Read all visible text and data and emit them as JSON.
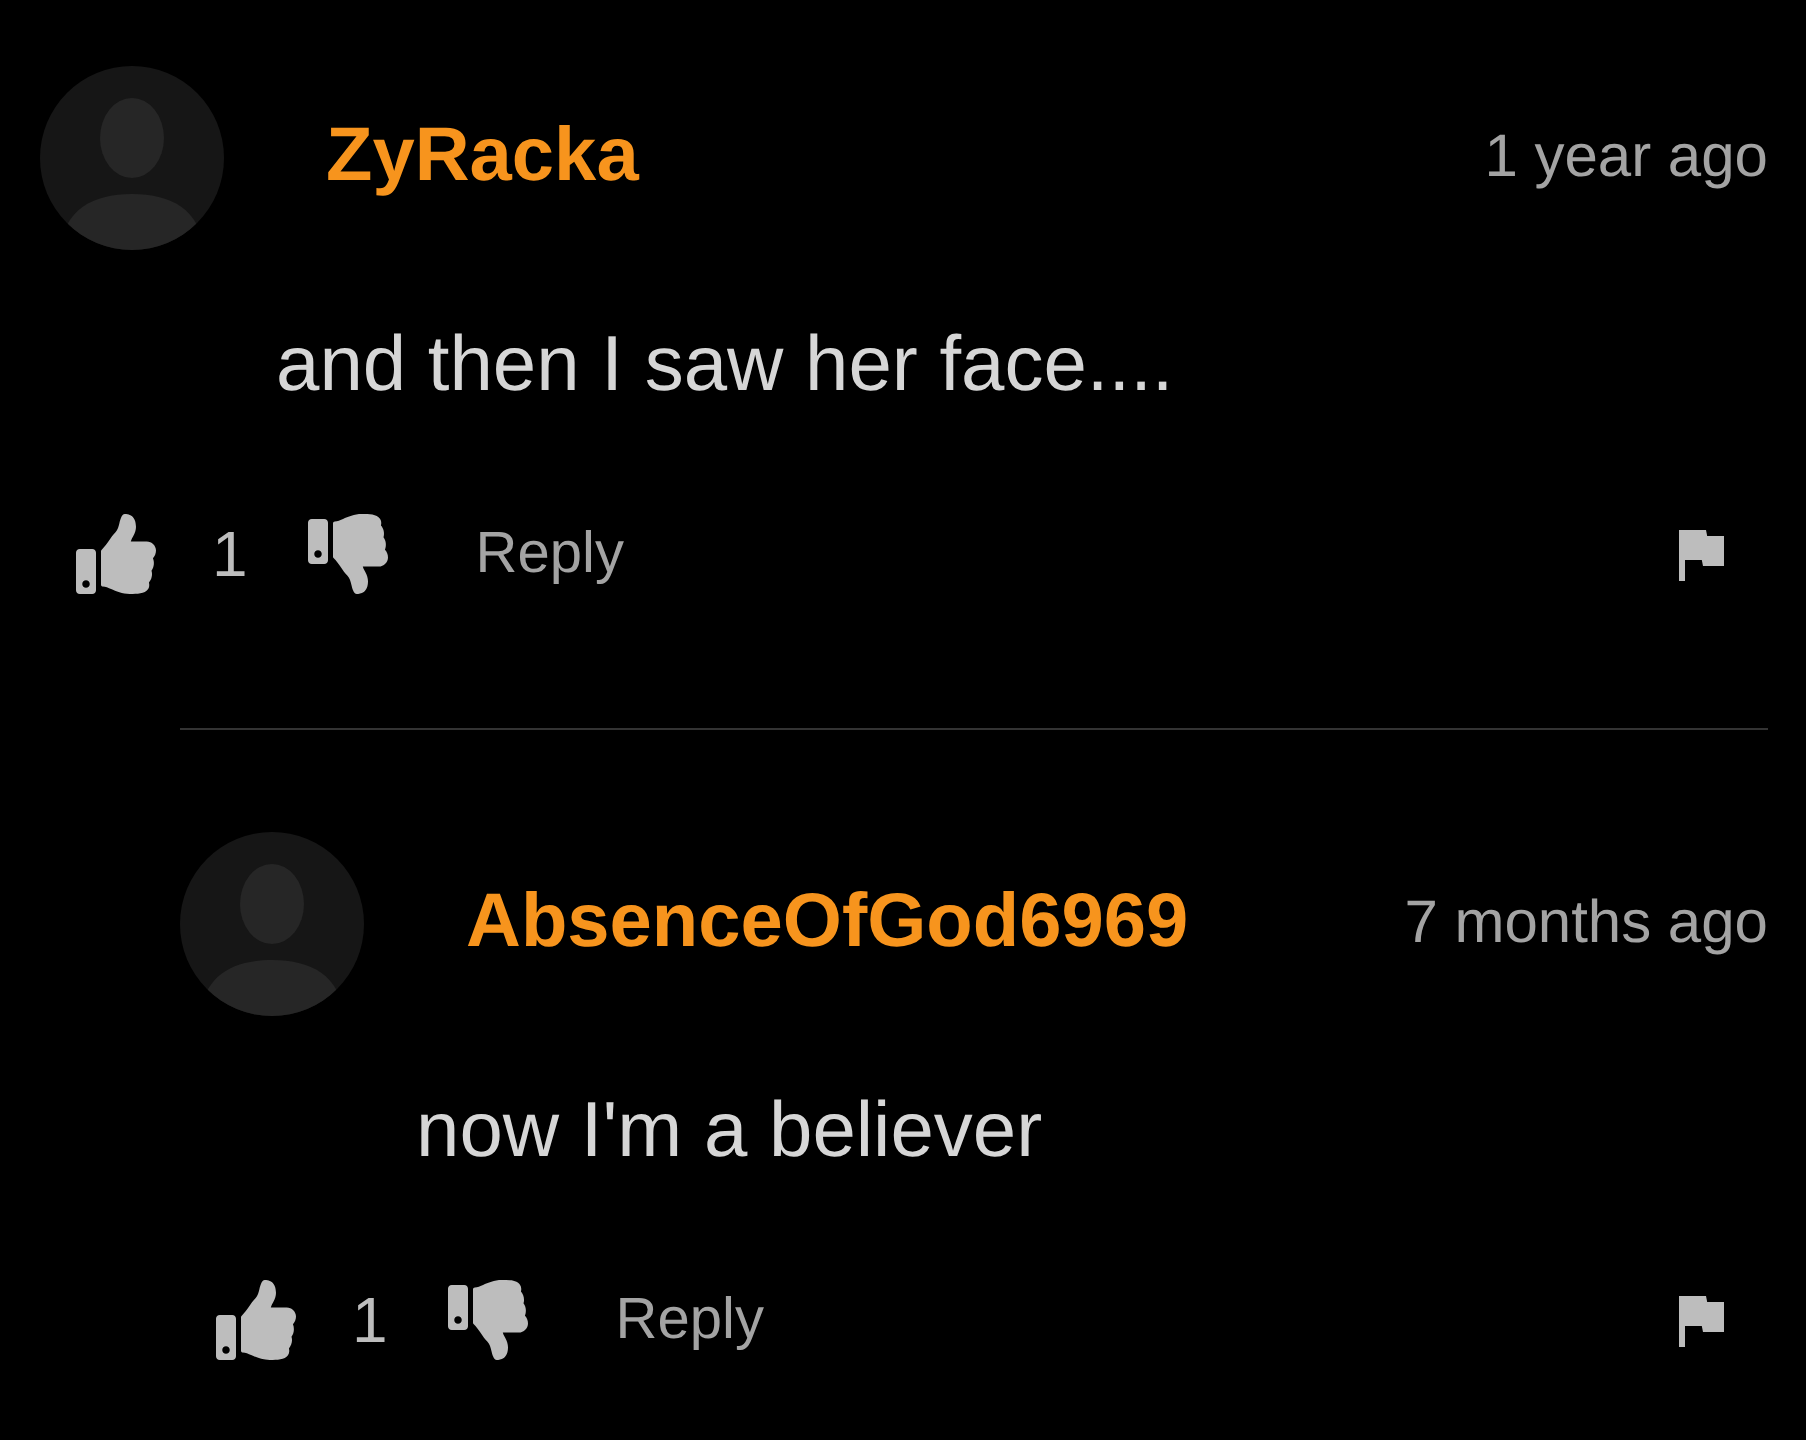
{
  "comments": [
    {
      "author": "ZyRacka",
      "time": "1 year ago",
      "text": "and then I saw her face....",
      "likes": "1",
      "reply_label": "Reply",
      "replies": [
        {
          "author": "AbsenceOfGod6969",
          "time": "7 months ago",
          "text": "now I'm a believer",
          "likes": "1",
          "reply_label": "Reply"
        }
      ]
    }
  ]
}
